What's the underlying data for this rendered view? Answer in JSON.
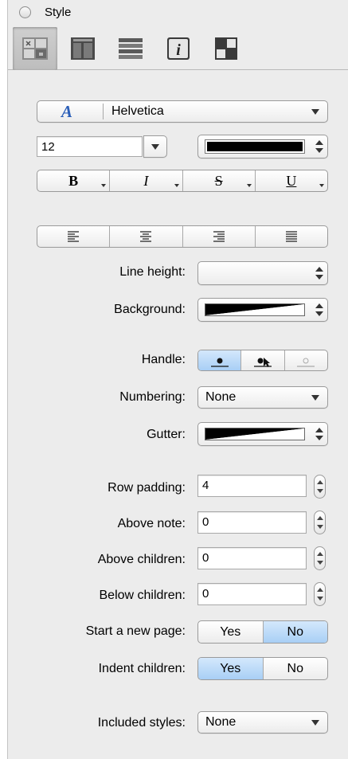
{
  "panel": {
    "title": "Style"
  },
  "toolbar": {
    "buttons": [
      {
        "name": "cell-style-icon"
      },
      {
        "name": "columns-icon"
      },
      {
        "name": "rows-icon"
      },
      {
        "name": "info-icon",
        "glyph": "i"
      },
      {
        "name": "checker-icon"
      }
    ]
  },
  "font": {
    "icon_glyph": "A",
    "family": "Helvetica",
    "size": "12",
    "color": "#000000",
    "bold_label": "B",
    "italic_label": "I",
    "strike_label": "S",
    "underline_label": "U"
  },
  "labels": {
    "line_height": "Line height:",
    "background": "Background:",
    "handle": "Handle:",
    "numbering": "Numbering:",
    "gutter": "Gutter:",
    "row_padding": "Row padding:",
    "above_note": "Above note:",
    "above_children": "Above children:",
    "below_children": "Below children:",
    "start_new_page": "Start a new page:",
    "indent_children": "Indent children:",
    "included_styles": "Included styles:"
  },
  "values": {
    "numbering": "None",
    "row_padding": "4",
    "above_note": "0",
    "above_children": "0",
    "below_children": "0",
    "start_new_page": {
      "yes": "Yes",
      "no": "No",
      "selected": "No"
    },
    "indent_children": {
      "yes": "Yes",
      "no": "No",
      "selected": "Yes"
    },
    "included_styles": "None"
  },
  "colors": {
    "selected_segment": "#a8cff5",
    "panel_bg": "#ececec"
  }
}
